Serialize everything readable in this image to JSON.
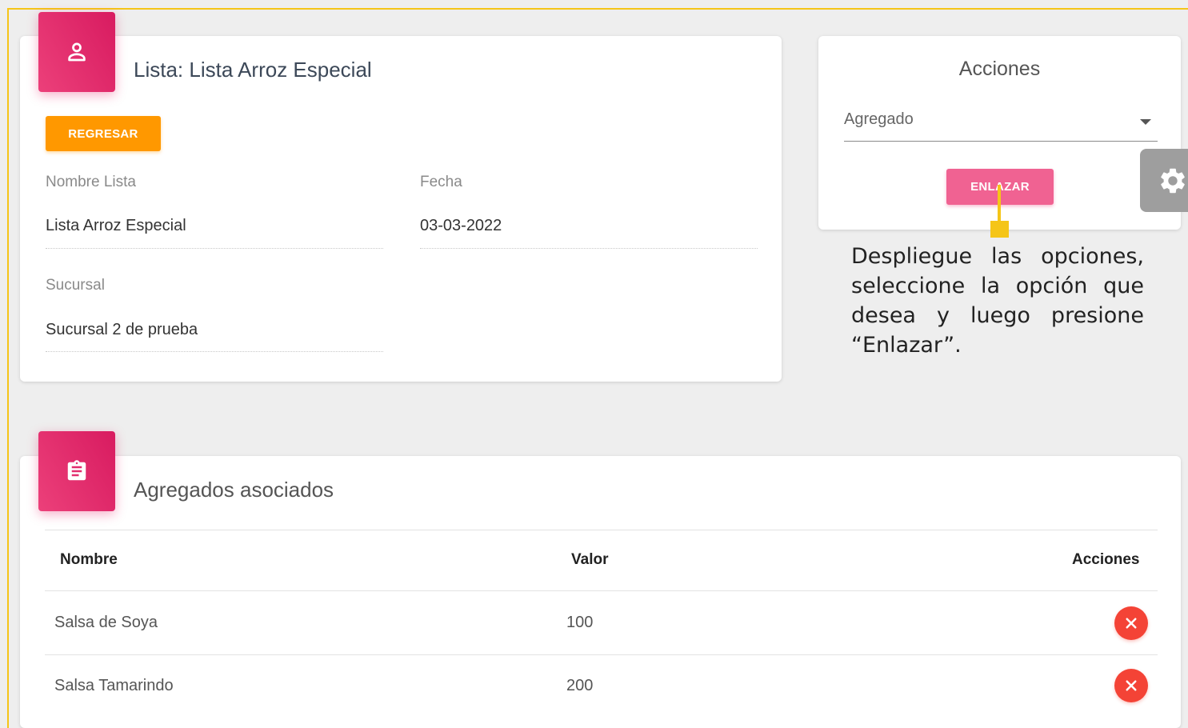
{
  "list_card": {
    "title": "Lista: Lista Arroz Especial",
    "back_button": "REGRESAR",
    "fields": [
      {
        "label": "Nombre Lista",
        "value": "Lista Arroz Especial"
      },
      {
        "label": "Fecha",
        "value": "03-03-2022"
      },
      {
        "label": "Sucursal",
        "value": "Sucursal 2 de prueba"
      }
    ]
  },
  "actions_card": {
    "title": "Acciones",
    "select_value": "Agregado",
    "link_button": "ENLAZAR"
  },
  "annotation": {
    "text": "Despliegue las opciones, seleccione la opción que desea y luego presione “Enlazar”."
  },
  "table_card": {
    "title": "Agregados asociados",
    "columns": [
      "Nombre",
      "Valor",
      "Acciones"
    ],
    "rows": [
      {
        "nombre": "Salsa de Soya",
        "valor": "100"
      },
      {
        "nombre": "Salsa Tamarindo",
        "valor": "200"
      }
    ]
  },
  "icons": {
    "list_badge": "user-icon",
    "table_badge": "clipboard-icon",
    "settings": "gear-icon",
    "delete": "close-icon"
  },
  "colors": {
    "primary_pink": "#e91e63",
    "orange": "#ff9800",
    "danger": "#f44336",
    "highlight": "#f5c518"
  }
}
